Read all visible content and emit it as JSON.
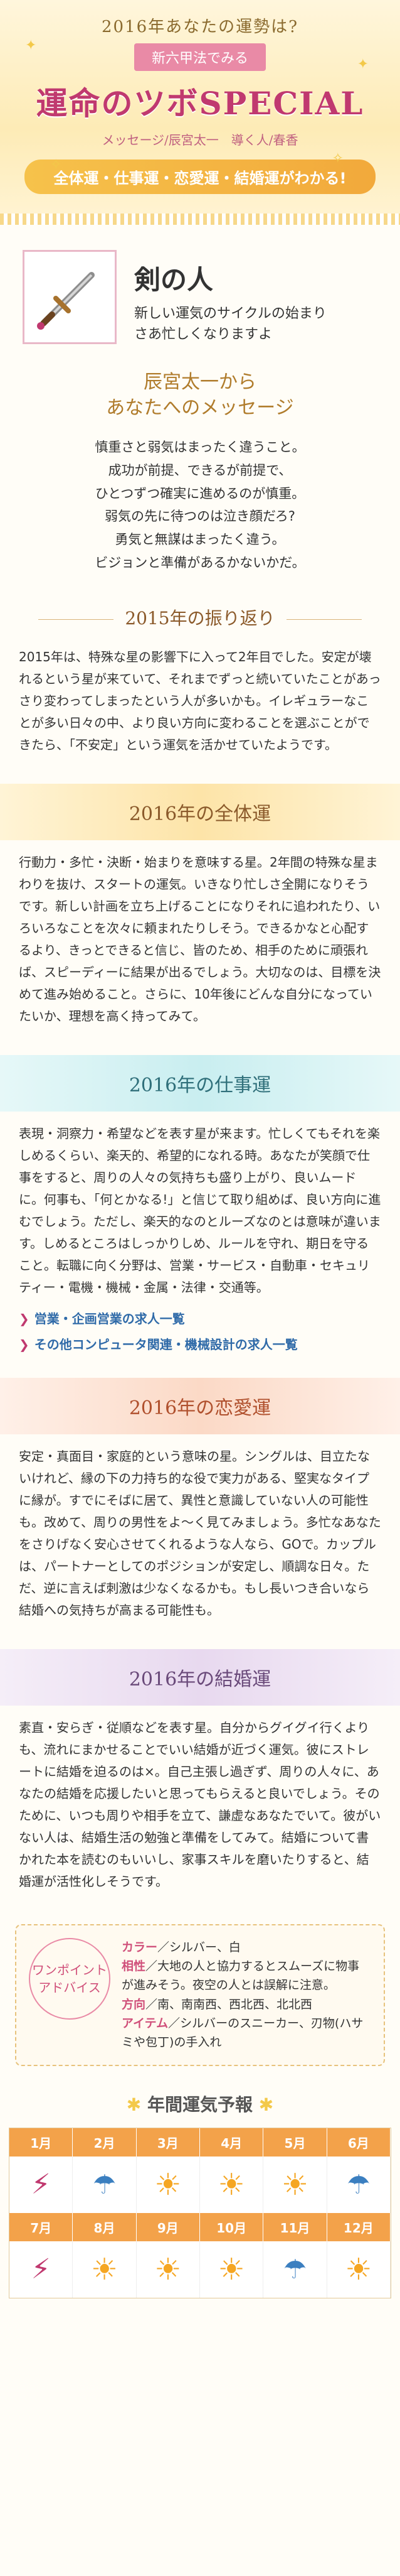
{
  "header": {
    "kicker": "2016年あなたの運勢は?",
    "ribbon": "新六甲法でみる",
    "title": "運命のツボSPECIAL",
    "credit": "メッセージ/辰宮太一　導く人/春香",
    "pill": "全体運・仕事運・恋愛運・結婚運がわかる!"
  },
  "hero": {
    "name": "剣の人",
    "subtitle_lines": [
      "新しい運気のサイクルの始まり",
      "さあ忙しくなりますよ"
    ],
    "icon": "sword-icon"
  },
  "message": {
    "title_line1": "辰宮太一から",
    "title_line2": "あなたへのメッセージ",
    "lines": [
      "慎重さと弱気はまったく違うこと。",
      "成功が前提、できるが前提で、",
      "ひとつずつ確実に進めるのが慎重。",
      "弱気の先に待つのは泣き顔だろ?",
      "勇気と無謀はまったく違う。",
      "ビジョンと準備があるかないかだ。"
    ]
  },
  "review": {
    "title": "2015年の振り返り",
    "text": "2015年は、特殊な星の影響下に入って2年目でした。安定が壊れるという星が来ていて、それまでずっと続いていたことがあっさり変わってしまったという人が多いかも。イレギュラーなことが多い日々の中、より良い方向に変わることを選ぶことができたら、「不安定」という運気を活かせていたようです。"
  },
  "sections": {
    "overall": {
      "title": "2016年の全体運",
      "text": "行動力・多忙・決断・始まりを意味する星。2年間の特殊な星まわりを抜け、スタートの運気。いきなり忙しさ全開になりそうです。新しい計画を立ち上げることになりそれに追われたり、いろいろなことを次々に頼まれたりしそう。できるかなと心配するより、きっとできると信じ、皆のため、相手のために頑張れば、スピーディーに結果が出るでしょう。大切なのは、目標を決めて進み始めること。さらに、10年後にどんな自分になっていたいか、理想を高く持ってみて。"
    },
    "work": {
      "title": "2016年の仕事運",
      "text": "表現・洞察力・希望などを表す星が来ます。忙しくてもそれを楽しめるくらい、楽天的、希望的になれる時。あなたが笑顔で仕事をすると、周りの人々の気持ちも盛り上がり、良いムードに。何事も、「何とかなる!」と信じて取り組めば、良い方向に進むでしょう。ただし、楽天的なのとルーズなのとは意味が違います。しめるところはしっかりしめ、ルールを守れ、期日を守ること。転職に向く分野は、営業・サービス・自動車・セキュリティー・電機・機械・金属・法律・交通等。",
      "links": [
        "営業・企画営業の求人一覧",
        "その他コンピュータ関連・機械設計の求人一覧"
      ]
    },
    "love": {
      "title": "2016年の恋愛運",
      "text": "安定・真面目・家庭的という意味の星。シングルは、目立たないけれど、縁の下の力持ち的な役で実力がある、堅実なタイプに縁が。すでにそばに居て、異性と意識していない人の可能性も。改めて、周りの男性をよ～く見てみましょう。多忙なあなたをさりげなく安心させてくれるような人なら、GOで。カップルは、パートナーとしてのポジションが安定し、順調な日々。ただ、逆に言えば刺激は少なくなるかも。もし長いつき合いなら結婚への気持ちが高まる可能性も。"
    },
    "marriage": {
      "title": "2016年の結婚運",
      "text": "素直・安らぎ・従順などを表す星。自分からグイグイ行くよりも、流れにまかせることでいい結婚が近づく運気。彼にストレートに結婚を迫るのは×。自己主張し過ぎず、周りの人々に、あなたの結婚を応援したいと思ってもらえると良いでしょう。そのために、いつも周りや相手を立て、謙虚なあなたでいて。彼がいない人は、結婚生活の勉強と準備をしてみて。結婚について書かれた本を読むのもいいし、家事スキルを磨いたりすると、結婚運が活性化しそうです。"
    }
  },
  "onepoint": {
    "badge_line1": "ワンポイント",
    "badge_line2": "アドバイス",
    "color_key": "カラー",
    "color_val": "／シルバー、白",
    "aisho_key": "相性",
    "aisho_val": "／大地の人と協力するとスムーズに物事が進みそう。夜空の人とは誤解に注意。",
    "dir_key": "方向",
    "dir_val": "／南、南南西、西北西、北北西",
    "item_key": "アイテム",
    "item_val": "／シルバーのスニーカー、刃物(ハサミや包丁)の手入れ"
  },
  "forecast": {
    "title": "年間運気予報",
    "months": [
      "1月",
      "2月",
      "3月",
      "4月",
      "5月",
      "6月",
      "7月",
      "8月",
      "9月",
      "10月",
      "11月",
      "12月"
    ],
    "weather": [
      "storm",
      "rain",
      "sun",
      "sun",
      "sun",
      "rain",
      "storm",
      "sun",
      "sun",
      "sun",
      "rain",
      "sun"
    ]
  },
  "colors": {
    "accent": "#c0396f",
    "gold": "#f3a24a"
  }
}
